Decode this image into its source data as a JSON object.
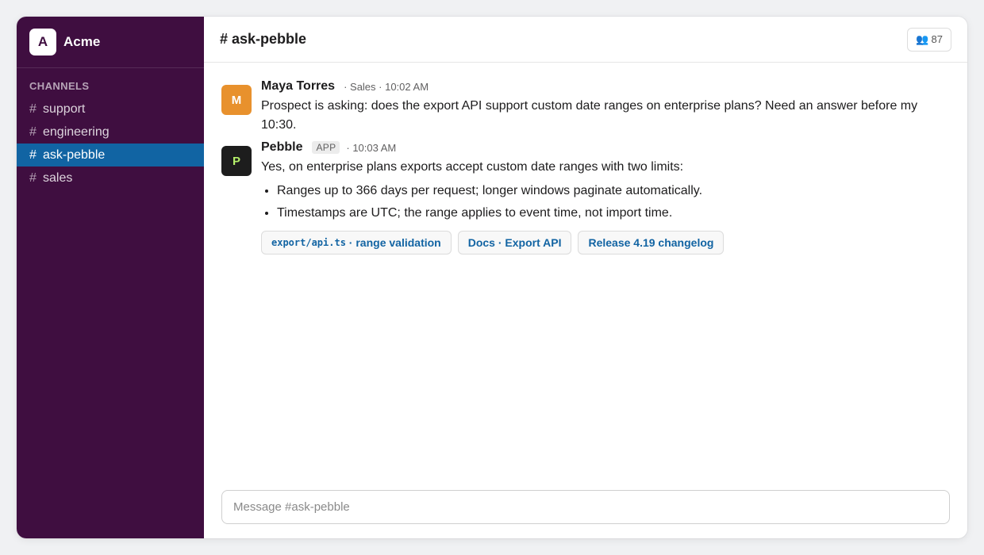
{
  "workspace": {
    "logo_letter": "A",
    "name": "Acme"
  },
  "sidebar": {
    "section_label": "CHANNELS",
    "channels": [
      {
        "hash": "#",
        "name": "support",
        "active": false
      },
      {
        "hash": "#",
        "name": "engineering",
        "active": false
      },
      {
        "hash": "#",
        "name": "ask-pebble",
        "active": true
      },
      {
        "hash": "#",
        "name": "sales",
        "active": false
      }
    ]
  },
  "header": {
    "title": "# ask-pebble",
    "members_icon": "people-icon",
    "members_count": "87"
  },
  "messages": [
    {
      "avatar_letter": "M",
      "avatar_color": "#e8912d",
      "author": "Maya Torres",
      "role": "· Sales · 10:02 AM",
      "text": "Prospect is asking: does the export API support custom date ranges on enterprise plans? Need an answer before my 10:30."
    },
    {
      "avatar_letter": "P",
      "avatar_color": "#1d1d1d",
      "avatar_text_color": "#b5f06a",
      "author": "Pebble",
      "badge": "APP",
      "time": "· 10:03 AM",
      "text": "Yes, on enterprise plans exports accept custom date ranges with two limits:",
      "bullets": [
        "Ranges up to 366 days per request; longer windows paginate automatically.",
        "Timestamps are UTC; the range applies to event time, not import time."
      ],
      "chips": [
        {
          "code": "export/api.ts",
          "label": " · range validation"
        },
        {
          "code": "",
          "label": "Docs · Export API"
        },
        {
          "code": "",
          "label": "Release 4.19 changelog"
        }
      ]
    }
  ],
  "composer": {
    "placeholder": "Message #ask-pebble"
  },
  "colors": {
    "sidebar_bg": "#3f0e40",
    "active_channel": "#1164a3",
    "link": "#1264a3"
  }
}
